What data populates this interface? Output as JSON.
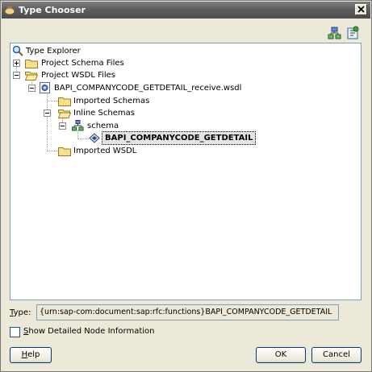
{
  "window": {
    "title": "Type Chooser"
  },
  "toolbar": {
    "btn1_icon": "hierarchy-icon",
    "btn2_icon": "refresh-icon"
  },
  "tree": {
    "root": "Type Explorer",
    "project_schema_files": "Project Schema Files",
    "project_wsdl_files": "Project WSDL Files",
    "wsdl_file": "BAPI_COMPANYCODE_GETDETAIL_receive.wsdl",
    "imported_schemas": "Imported Schemas",
    "inline_schemas": "Inline Schemas",
    "schema": "schema",
    "element": "BAPI_COMPANYCODE_GETDETAIL",
    "imported_wsdl": "Imported WSDL"
  },
  "type": {
    "label_mnemonic": "T",
    "label_rest": "ype:",
    "value": "{urn:sap-com:document:sap:rfc:functions}BAPI_COMPANYCODE_GETDETAIL"
  },
  "show_detailed": {
    "checked": false,
    "label_mnemonic": "S",
    "label_rest": "how Detailed Node Information"
  },
  "buttons": {
    "help_mnemonic": "H",
    "help_rest": "elp",
    "ok": "OK",
    "cancel": "Cancel"
  }
}
